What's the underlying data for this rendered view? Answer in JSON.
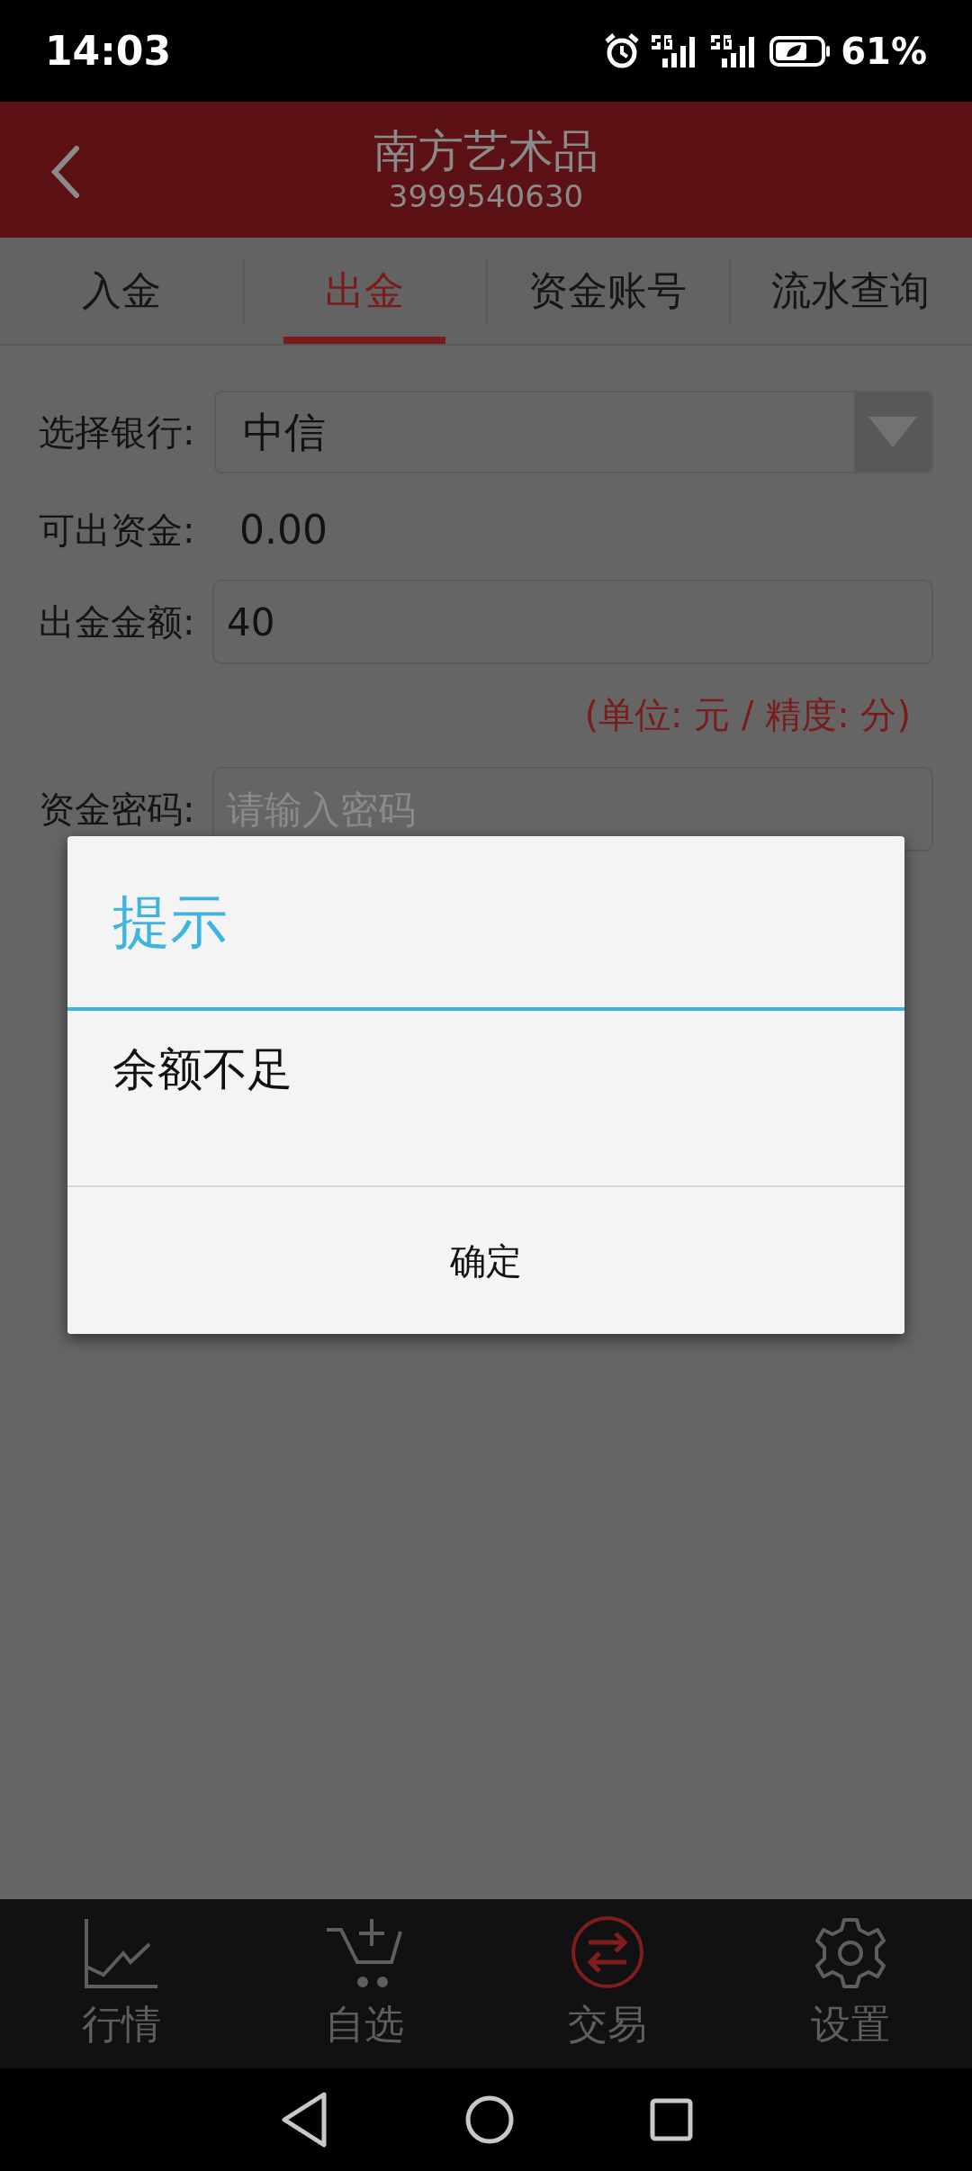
{
  "status_bar": {
    "time": "14:03",
    "battery": "61%"
  },
  "header": {
    "title": "南方艺术品",
    "subtitle": "3999540630"
  },
  "tabs": [
    {
      "label": "入金",
      "selected": false
    },
    {
      "label": "出金",
      "selected": true
    },
    {
      "label": "资金账号",
      "selected": false
    },
    {
      "label": "流水查询",
      "selected": false
    }
  ],
  "form": {
    "bank": {
      "label": "选择银行:",
      "value": "中信"
    },
    "available": {
      "label": "可出资金:",
      "value": "0.00"
    },
    "amount": {
      "label": "出金金额:",
      "value": "40"
    },
    "unit_note": "(单位: 元 / 精度: 分)",
    "password": {
      "label": "资金密码:",
      "placeholder": "请输入密码"
    }
  },
  "dialog": {
    "title": "提示",
    "message": "余额不足",
    "button": "确定"
  },
  "bottom_nav": [
    {
      "label": "行情",
      "kind": "chart",
      "selected": false
    },
    {
      "label": "自选",
      "kind": "cart",
      "selected": false
    },
    {
      "label": "交易",
      "kind": "exchange",
      "selected": true
    },
    {
      "label": "设置",
      "kind": "gear",
      "selected": false
    }
  ]
}
